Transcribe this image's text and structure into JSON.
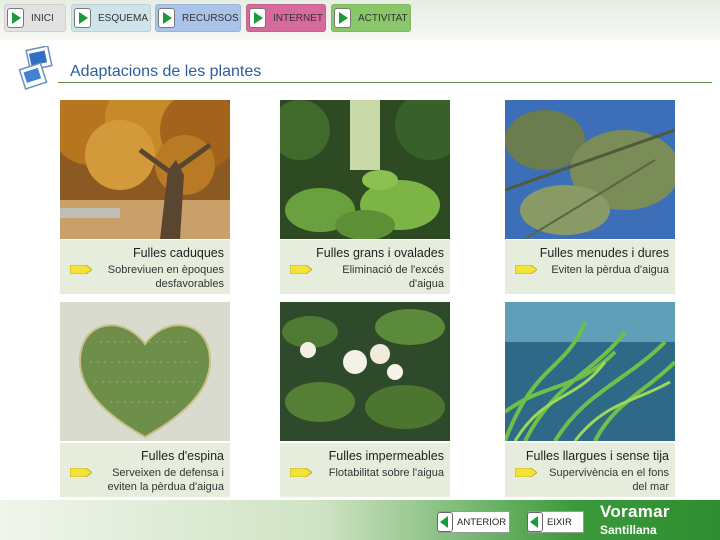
{
  "nav": {
    "inici": "INICI",
    "esquema": "ESQUEMA",
    "recursos": "RECURSOS",
    "internet": "INTERNET",
    "activitat": "ACTIVITAT"
  },
  "page": {
    "title": "Adaptacions de les plantes"
  },
  "cards": [
    {
      "title": "Fulles caduques",
      "desc": "Sobreviuen en èpoques desfavorables",
      "image": "autumn-beech-tree"
    },
    {
      "title": "Fulles grans i ovalades",
      "desc": "Eliminació de l'excés d'aigua",
      "image": "rainforest-undergrowth"
    },
    {
      "title": "Fulles menudes i dures",
      "desc": "Eviten la pèrdua d'aigua",
      "image": "olive-tree-branches"
    },
    {
      "title": "Fulles d'espina",
      "desc": "Serveixen de defensa i eviten la pèrdua d'aigua",
      "image": "heart-shaped-cactus"
    },
    {
      "title": "Fulles impermeables",
      "desc": "Flotabilitat sobre l'aigua",
      "image": "water-lilies"
    },
    {
      "title": "Fulles llargues i sense tija",
      "desc": "Supervivència en el fons del mar",
      "image": "seagrass-underwater"
    }
  ],
  "bottom": {
    "anterior": "ANTERIOR",
    "eixir": "EIXIR",
    "brand_line1": "Voramar",
    "brand_line2": "Santillana"
  },
  "colors": {
    "title": "#2b5e9e",
    "caption_bg": "#e6eddd",
    "bullet": "#f2e23a",
    "brand_green": "#2f8c30"
  }
}
